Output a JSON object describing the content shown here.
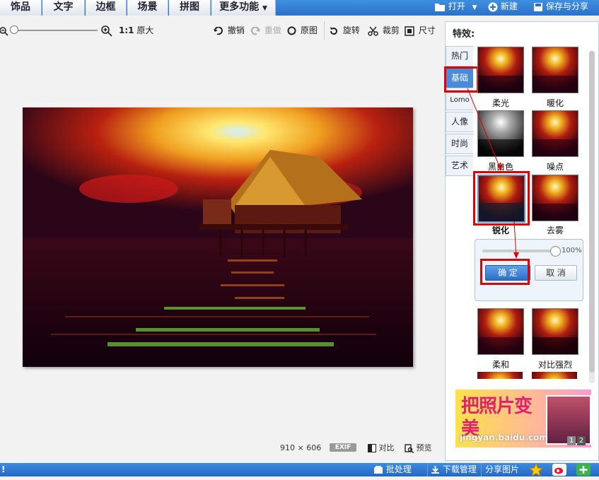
{
  "top_tabs": [
    "饰品",
    "文字",
    "边框",
    "场景",
    "拼图",
    "更多功能"
  ],
  "top_actions": {
    "open": "打开",
    "new": "新建",
    "save": "保存与分享"
  },
  "toolbar": {
    "ratio": "1:1",
    "original_size": "原大",
    "undo": "撤销",
    "redo": "重做",
    "original": "原图",
    "rotate": "旋转",
    "crop": "裁剪",
    "size": "尺寸"
  },
  "panel": {
    "title": "特效:",
    "categories": [
      "热门",
      "基础",
      "Lomo",
      "人像",
      "时尚",
      "艺术"
    ],
    "effects": [
      "柔光",
      "暖化",
      "黑白色",
      "噪点",
      "锐化",
      "去雾",
      "柔和",
      "对比强烈"
    ],
    "slider_percent": "100%",
    "confirm": "确 定",
    "cancel": "取 消",
    "ad_text": "把照片变美",
    "ad_pages": [
      "1",
      "2"
    ]
  },
  "footer": {
    "dimensions": "910 × 606",
    "exif": "EXIF",
    "compare": "对比",
    "preview": "预览"
  },
  "statusbar": {
    "batch": "批处理",
    "download": "下载管理",
    "share": "分享图片",
    "left_mark": "!"
  },
  "watermark": "jingyan.baidu.com",
  "colors": {
    "accent": "#2a72c9",
    "highlight": "#e00000"
  }
}
